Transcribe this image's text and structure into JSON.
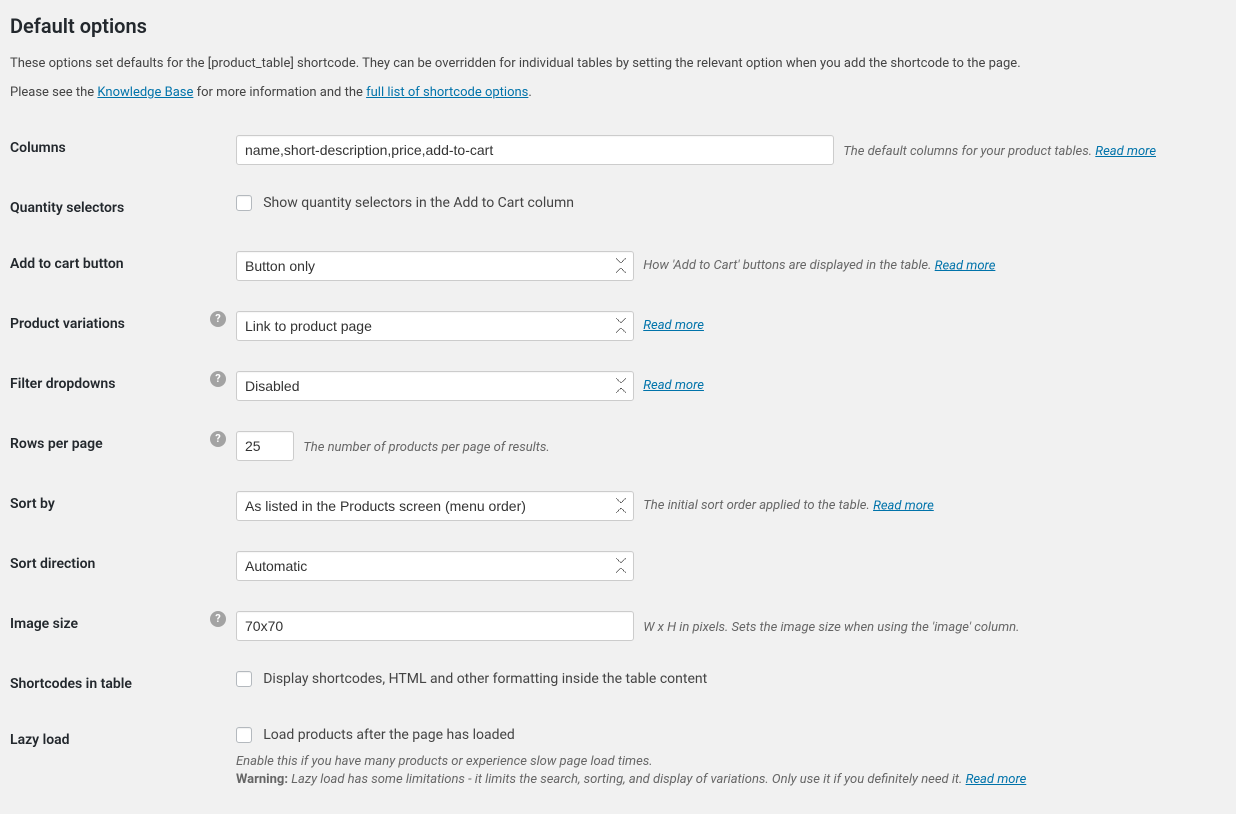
{
  "heading": "Default options",
  "intro1": "These options set defaults for the [product_table] shortcode. They can be overridden for individual tables by setting the relevant option when you add the shortcode to the page.",
  "intro2_pre": "Please see the ",
  "intro2_link1": "Knowledge Base",
  "intro2_mid": " for more information and the ",
  "intro2_link2": "full list of shortcode options",
  "intro2_post": ".",
  "read_more": "Read more",
  "columns": {
    "label": "Columns",
    "value": "name,short-description,price,add-to-cart",
    "desc": "The default columns for your product tables."
  },
  "quantity": {
    "label": "Quantity selectors",
    "checkbox": "Show quantity selectors in the Add to Cart column"
  },
  "add_to_cart": {
    "label": "Add to cart button",
    "value": "Button only",
    "desc": "How 'Add to Cart' buttons are displayed in the table."
  },
  "variations": {
    "label": "Product variations",
    "value": "Link to product page"
  },
  "filters": {
    "label": "Filter dropdowns",
    "value": "Disabled"
  },
  "rows": {
    "label": "Rows per page",
    "value": "25",
    "desc": "The number of products per page of results."
  },
  "sort_by": {
    "label": "Sort by",
    "value": "As listed in the Products screen (menu order)",
    "desc": "The initial sort order applied to the table."
  },
  "sort_dir": {
    "label": "Sort direction",
    "value": "Automatic"
  },
  "image_size": {
    "label": "Image size",
    "value": "70x70",
    "desc": "W x H in pixels. Sets the image size when using the 'image' column."
  },
  "shortcodes": {
    "label": "Shortcodes in table",
    "checkbox": "Display shortcodes, HTML and other formatting inside the table content"
  },
  "lazy": {
    "label": "Lazy load",
    "checkbox": "Load products after the page has loaded",
    "desc1": "Enable this if you have many products or experience slow page load times.",
    "warn_label": "Warning:",
    "warn_text": " Lazy load has some limitations - it limits the search, sorting, and display of variations. Only use it if you definitely need it."
  }
}
